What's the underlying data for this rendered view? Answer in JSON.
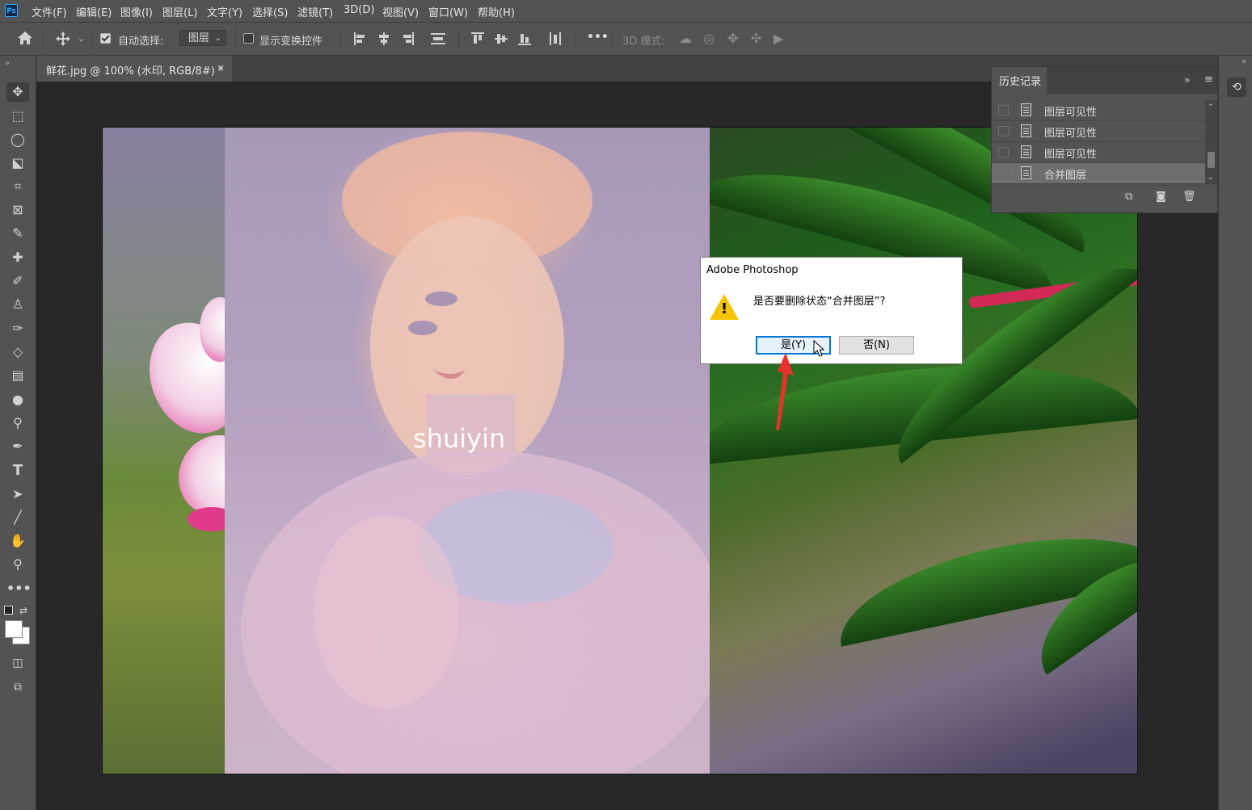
{
  "menubar": {
    "logo": "Ps",
    "items": [
      "文件(F)",
      "编辑(E)",
      "图像(I)",
      "图层(L)",
      "文字(Y)",
      "选择(S)",
      "滤镜(T)",
      "3D(D)",
      "视图(V)",
      "窗口(W)",
      "帮助(H)"
    ]
  },
  "options": {
    "auto_select_label": "自动选择:",
    "auto_select_checked": true,
    "auto_select_target": "图层",
    "show_transform_label": "显示变换控件",
    "show_transform_checked": false,
    "more_label": "•••",
    "mode_3d_label": "3D 模式:"
  },
  "document": {
    "tab_label": "鲜花.jpg @ 100% (水印, RGB/8#) *",
    "close": "×",
    "watermark_text": "shuiyin"
  },
  "history_panel": {
    "title": "历史记录",
    "items": [
      {
        "label": "图层可见性",
        "selected": false
      },
      {
        "label": "图层可见性",
        "selected": false
      },
      {
        "label": "图层可见性",
        "selected": false
      },
      {
        "label": "合并图层",
        "selected": true
      }
    ]
  },
  "dialog": {
    "title": "Adobe Photoshop",
    "message": "是否要删除状态“合并图层”?",
    "yes_label": "是(Y)",
    "no_label": "否(N)"
  },
  "colors": {
    "accent": "#31a8ff",
    "panel": "#535353",
    "arrow": "#e8322b",
    "warning": "#f5c400"
  },
  "icons": [
    "home-icon",
    "move-icon",
    "align-icons",
    "3d-mode-icons",
    "history-icon"
  ]
}
